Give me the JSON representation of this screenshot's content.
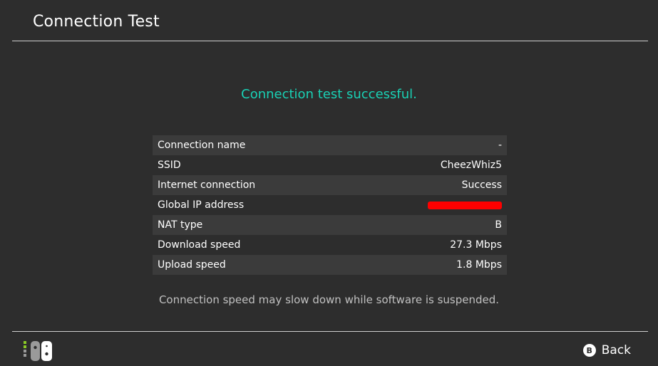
{
  "header": {
    "title": "Connection Test"
  },
  "status": {
    "message": "Connection test successful.",
    "color": "#19d1b5"
  },
  "info_rows": [
    {
      "label": "Connection name",
      "value": "-"
    },
    {
      "label": "SSID",
      "value": "CheezWhiz5"
    },
    {
      "label": "Internet connection",
      "value": "Success"
    },
    {
      "label": "Global IP address",
      "value": "",
      "redacted": true
    },
    {
      "label": "NAT type",
      "value": "B"
    },
    {
      "label": "Download speed",
      "value": "27.3 Mbps"
    },
    {
      "label": "Upload speed",
      "value": "1.8 Mbps"
    }
  ],
  "note": "Connection speed may slow down while software is suspended.",
  "footer": {
    "controller_icon": "joy-con-controller-icon",
    "back_button_glyph": "B",
    "back_label": "Back"
  },
  "colors": {
    "background": "#2d2d2d",
    "row_shade": "#3b3b3b",
    "accent": "#19d1b5",
    "redaction": "#ff0000"
  }
}
